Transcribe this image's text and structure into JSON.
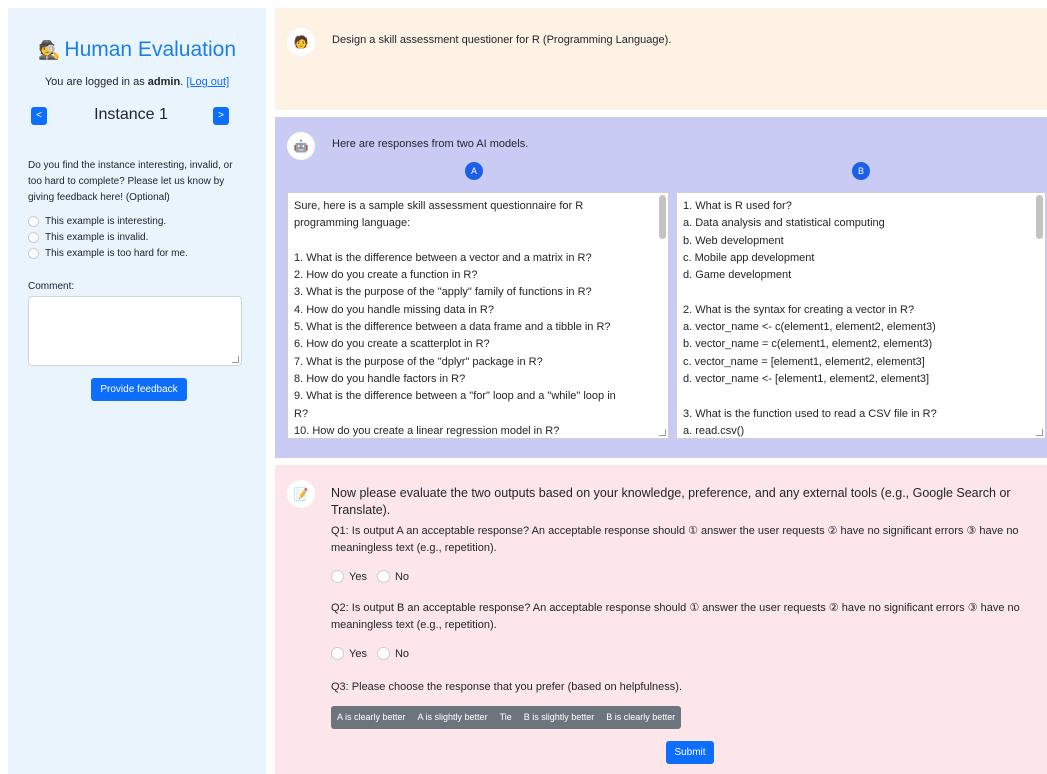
{
  "sidebar": {
    "title_icon": "detective-emoji",
    "title": "Human Evaluation",
    "login_prefix": "You are logged in as",
    "login_user": "admin",
    "login_suffix_open": ".",
    "logout_label": "[Log out]",
    "prev_label": "<",
    "next_label": ">",
    "instance_title": "Instance 1",
    "feedback_question": "Do you find the instance interesting, invalid, or too hard to complete? Please let us know by giving feedback here! (Optional)",
    "feedback_options": [
      "This example is interesting.",
      "This example is invalid.",
      "This example is too hard for me."
    ],
    "comment_label": "Comment:",
    "feedback_button": "Provide feedback"
  },
  "user_turn": {
    "avatar_icon": "user-avatar-emoji",
    "text": "Design a skill assessment questioner for R (Programming Language)."
  },
  "models_turn": {
    "avatar_icon": "robot-avatar-emoji",
    "text": "Here are responses from two AI models.",
    "badge_a": "A",
    "badge_b": "B",
    "response_a_lines": [
      "Sure, here is a sample skill assessment questionnaire for R",
      "programming language:",
      "",
      "1. What is the difference between a vector and a matrix in R?",
      "2. How do you create a function in R?",
      "3. What is the purpose of the \"apply\" family of functions in R?",
      "4. How do you handle missing data in R?",
      "5. What is the difference between a data frame and a tibble in R?",
      "6. How do you create a scatterplot in R?",
      "7. What is the purpose of the \"dplyr\" package in R?",
      "8. How do you handle factors in R?",
      "9. What is the difference between a \"for\" loop and a \"while\" loop in",
      "R?",
      "10. How do you create a linear regression model in R?"
    ],
    "response_b_lines": [
      "1. What is R used for?",
      "a. Data analysis and statistical computing",
      "b. Web development",
      "c. Mobile app development",
      "d. Game development",
      "",
      "2. What is the syntax for creating a vector in R?",
      "a. vector_name <- c(element1, element2, element3)",
      "b. vector_name = c(element1, element2, element3)",
      "c. vector_name = [element1, element2, element3]",
      "d. vector_name <- [element1, element2, element3]",
      "",
      "3. What is the function used to read a CSV file in R?",
      "a. read.csv()"
    ]
  },
  "evaluation": {
    "avatar_icon": "memo-avatar-emoji",
    "heading": "Now please evaluate the two outputs based on your knowledge, preference, and any external tools (e.g., Google Search or Translate).",
    "q1": "Q1: Is output A an acceptable response? An acceptable response should ① answer the user requests ② have no significant errors ③ have no meaningless text (e.g., repetition).",
    "q2": "Q2: Is output B an acceptable response? An acceptable response should ① answer the user requests ② have no significant errors ③ have no meaningless text (e.g., repetition).",
    "yes_label": "Yes",
    "no_label": "No",
    "q3": "Q3: Please choose the response that you prefer (based on helpfulness).",
    "preference_options": [
      "A is clearly better",
      "A is slightly better",
      "Tie",
      "B is slightly better",
      "B is clearly better"
    ],
    "submit_label": "Submit"
  },
  "colors": {
    "sidebar_bg": "#eaf4fd",
    "title_blue": "#1c7fe9",
    "button_blue": "#0d6efd",
    "user_panel_bg": "#fef2e5",
    "models_panel_bg": "#cacbf4",
    "eval_panel_bg": "#fde6ea",
    "model_badge": "#1c60ea",
    "pref_group_bg": "#6c757d"
  }
}
